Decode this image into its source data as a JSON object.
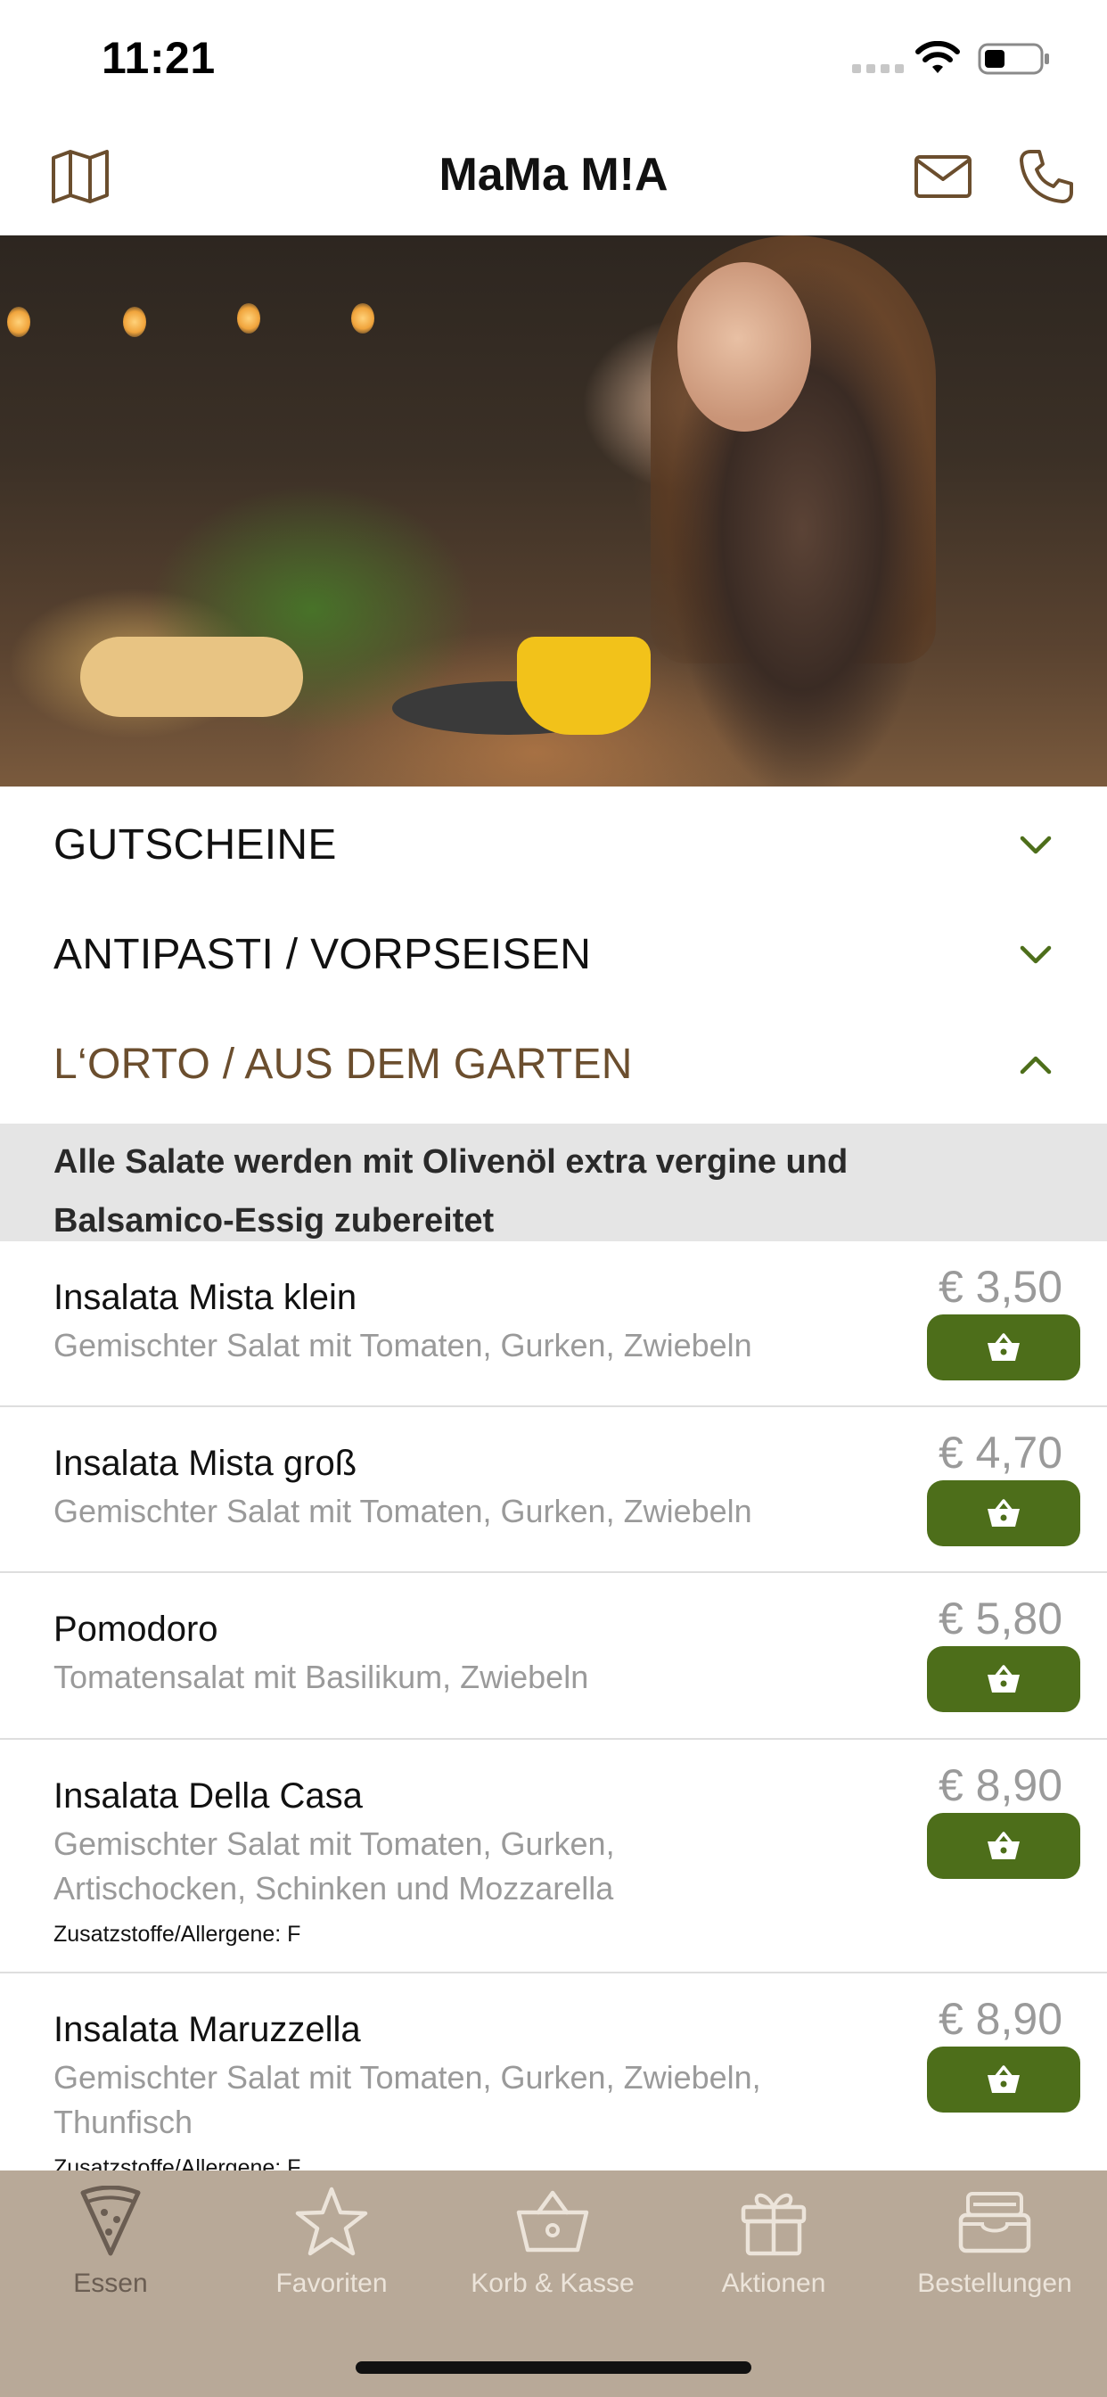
{
  "status_bar": {
    "time": "11:21"
  },
  "nav": {
    "title": "MaMa M!A"
  },
  "categories": [
    {
      "label": "GUTSCHEINE",
      "expanded": false
    },
    {
      "label": "ANTIPASTI / VORPSEISEN",
      "expanded": false
    },
    {
      "label": "L‘ORTO / AUS DEM GARTEN",
      "expanded": true
    }
  ],
  "info_banner": {
    "line1": "Alle Salate werden mit Olivenöl extra vergine und",
    "line2": "Balsamico-Essig zubereitet"
  },
  "items": [
    {
      "name": "Insalata Mista klein",
      "desc": "Gemischter Salat mit Tomaten, Gurken, Zwiebeln",
      "price": "€ 3,50"
    },
    {
      "name": "Insalata Mista groß",
      "desc": "Gemischter Salat mit Tomaten, Gurken, Zwiebeln",
      "price": "€ 4,70"
    },
    {
      "name": "Pomodoro",
      "desc": "Tomatensalat mit Basilikum, Zwiebeln",
      "price": "€ 5,80"
    },
    {
      "name": "Insalata Della Casa",
      "desc": "Gemischter Salat mit Tomaten, Gurken, Artischocken, Schinken und Mozzarella",
      "allergen": "Zusatzstoffe/Allergene: F",
      "price": "€ 8,90"
    },
    {
      "name": "Insalata Maruzzella",
      "desc": "Gemischter Salat mit Tomaten, Gurken, Zwiebeln, Thunfisch",
      "allergen": "Zusatzstoffe/Allergene: F",
      "price": "€ 8,90"
    }
  ],
  "tabs": [
    {
      "label": "Essen",
      "icon": "pizza-slice-icon"
    },
    {
      "label": "Favoriten",
      "icon": "star-icon"
    },
    {
      "label": "Korb & Kasse",
      "icon": "basket-icon"
    },
    {
      "label": "Aktionen",
      "icon": "gift-icon"
    },
    {
      "label": "Bestellungen",
      "icon": "inbox-tray-icon"
    }
  ],
  "colors": {
    "accent_green": "#4d6e1a",
    "active_category": "#6b4e2e",
    "tab_bar_bg": "#b8a998",
    "banner_bg": "#e5e5e5"
  }
}
